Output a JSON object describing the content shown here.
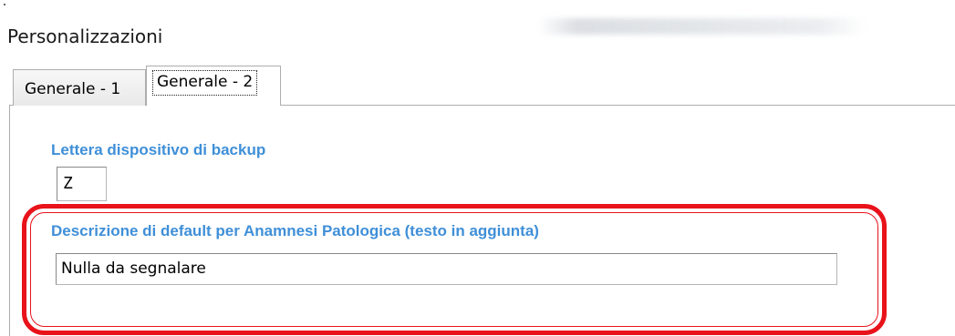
{
  "window": {
    "title": "Personalizzazioni"
  },
  "tabs": [
    {
      "label": "Generale - 1",
      "active": false
    },
    {
      "label": "Generale - 2",
      "active": true
    }
  ],
  "fields": {
    "backup_letter": {
      "label": "Lettera dispositivo di backup",
      "value": "Z"
    },
    "anamnesi": {
      "label": "Descrizione di default per Anamnesi Patologica (testo in aggiunta)",
      "value": "Nulla da segnalare"
    }
  },
  "colors": {
    "label_blue": "#3f8fd8",
    "highlight_red": "#e8131b",
    "tab_border": "#adadad"
  }
}
